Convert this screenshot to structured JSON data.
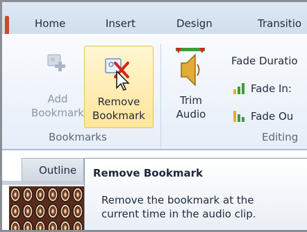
{
  "tabs": [
    "Home",
    "Insert",
    "Design",
    "Transitio"
  ],
  "ribbon": {
    "add_bookmark": [
      "Add",
      "Bookmark"
    ],
    "remove_bookmark": [
      "Remove",
      "Bookmark"
    ],
    "trim_audio": [
      "Trim",
      "Audio"
    ],
    "group_bookmarks": "Bookmarks",
    "fade_duration": "Fade Duratio",
    "fade_in": "Fade In:",
    "fade_out": "Fade Ou",
    "group_editing": "Editing"
  },
  "panes": {
    "outline_tab": "Outline"
  },
  "tooltip": {
    "title": "Remove Bookmark",
    "lines": [
      "Remove the bookmark at the",
      "current time in the audio clip."
    ]
  },
  "colors": {
    "tab_bar": "#dfe8f4",
    "ribbon_bg": "#f9fbfe",
    "hover_highlight": "#ffe59a",
    "disabled_text": "#8a96a8",
    "accent_red": "#d2472a"
  },
  "icons": {
    "add_bookmark": "add-bookmark-icon",
    "remove_bookmark": "remove-bookmark-icon",
    "trim_audio": "trim-audio-icon",
    "fade_in": "fade-in-icon",
    "fade_out": "fade-out-icon",
    "cursor": "mouse-pointer-icon"
  }
}
